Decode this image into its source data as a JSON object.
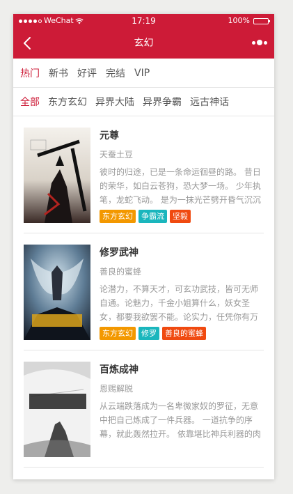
{
  "status_bar": {
    "carrier": "WeChat",
    "time": "17:19",
    "battery_text": "100%",
    "battery_level": 1.0
  },
  "nav": {
    "title": "玄幻"
  },
  "sort_tabs": [
    {
      "label": "热门",
      "active": true
    },
    {
      "label": "新书",
      "active": false
    },
    {
      "label": "好评",
      "active": false
    },
    {
      "label": "完结",
      "active": false
    },
    {
      "label": "VIP",
      "active": false
    }
  ],
  "category_tabs": [
    {
      "label": "全部",
      "active": true
    },
    {
      "label": "东方玄幻",
      "active": false
    },
    {
      "label": "异界大陆",
      "active": false
    },
    {
      "label": "异界争霸",
      "active": false
    },
    {
      "label": "远古神话",
      "active": false
    }
  ],
  "books": [
    {
      "title": "元尊",
      "author": "天蚕土豆",
      "description": "彼时的归途，已是一条命运徊昼的路。 昔日的荣华，如白云苍狗，恐大梦一场。 少年执笔，龙蛇飞动。 是为一抹光芒劈开昏气沉沉的世间。 而后，万剑",
      "cover_title": "元尊",
      "cover_author": "天蚕土豆",
      "tags": [
        {
          "label": "东方玄幻",
          "color": "#f39800"
        },
        {
          "label": "争霸流",
          "color": "#1ab6bd"
        },
        {
          "label": "坚毅",
          "color": "#f04a10"
        }
      ]
    },
    {
      "title": "修罗武神",
      "author": "善良的蜜蜂",
      "description": "论潜力，不算天才，可玄功武技，皆可无师自通。论魅力，千金小姐算什么，妖女圣女，都要我欲罢不能。论实力，任凭你有万千至宝，但我有",
      "cover_title": "修罗武神",
      "cover_author": "善良的蜜蜂",
      "tags": [
        {
          "label": "东方玄幻",
          "color": "#f39800"
        },
        {
          "label": "修罗",
          "color": "#1ab6bd"
        },
        {
          "label": "善良的蜜蜂",
          "color": "#f04a10"
        }
      ]
    },
    {
      "title": "百炼成神",
      "author": "恩赐解脱",
      "description": "从云端跌落成为一名卑微家奴的罗征，无意中把自己炼成了一件兵器。 一道抗争的序幕，就此轰然拉开。 依靠堪比神兵利器的肉身，罗征一路",
      "cover_title": "百炼成神",
      "cover_author": "恩赐解脱 作品",
      "tags": []
    }
  ],
  "colors": {
    "brand": "#cd1b37"
  }
}
